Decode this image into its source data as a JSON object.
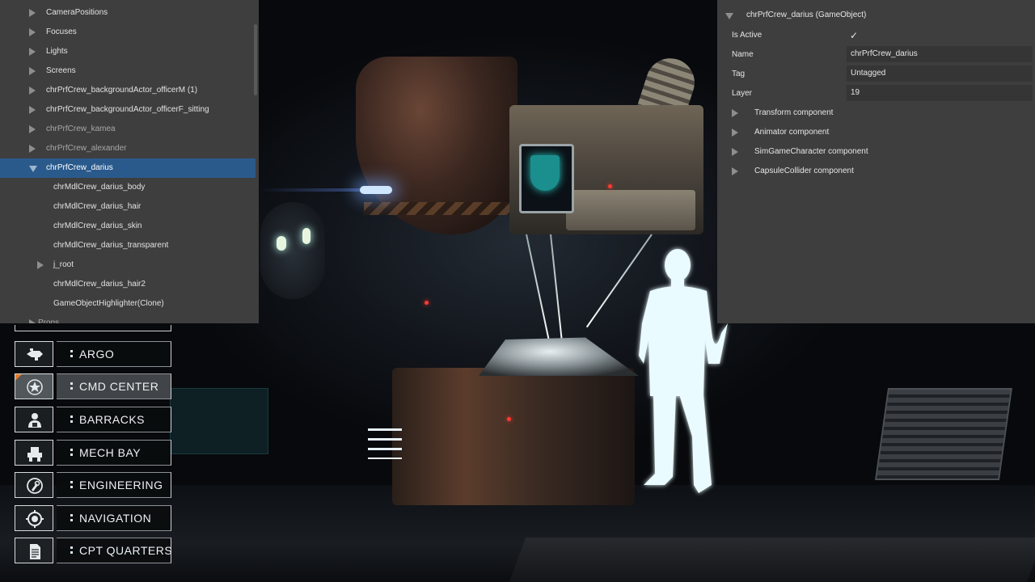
{
  "hierarchy": {
    "items": [
      {
        "label": "CameraPositions",
        "expander": "collapsed",
        "style": "normal"
      },
      {
        "label": "Focuses",
        "expander": "collapsed",
        "style": "normal"
      },
      {
        "label": "Lights",
        "expander": "collapsed",
        "style": "normal"
      },
      {
        "label": "Screens",
        "expander": "collapsed",
        "style": "normal"
      },
      {
        "label": "chrPrfCrew_backgroundActor_officerM (1)",
        "expander": "collapsed",
        "style": "normal"
      },
      {
        "label": "chrPrfCrew_backgroundActor_officerF_sitting",
        "expander": "collapsed",
        "style": "normal"
      },
      {
        "label": "chrPrfCrew_kamea",
        "expander": "collapsed",
        "style": "dim"
      },
      {
        "label": "chrPrfCrew_alexander",
        "expander": "collapsed",
        "style": "dim"
      },
      {
        "label": "chrPrfCrew_darius",
        "expander": "expanded",
        "style": "selected"
      },
      {
        "label": "chrMdlCrew_darius_body",
        "expander": "none",
        "style": "normal"
      },
      {
        "label": "chrMdlCrew_darius_hair",
        "expander": "none",
        "style": "normal"
      },
      {
        "label": "chrMdlCrew_darius_skin",
        "expander": "none",
        "style": "normal"
      },
      {
        "label": "chrMdlCrew_darius_transparent",
        "expander": "none",
        "style": "normal"
      },
      {
        "label": "j_root",
        "expander": "collapsed",
        "style": "normal"
      },
      {
        "label": "chrMdlCrew_darius_hair2",
        "expander": "none",
        "style": "normal"
      },
      {
        "label": "GameObjectHighlighter(Clone)",
        "expander": "none",
        "style": "normal"
      },
      {
        "label": "Props",
        "expander": "collapsed",
        "style": "dim"
      }
    ]
  },
  "inspector": {
    "title": "chrPrfCrew_darius (GameObject)",
    "is_active_label": "Is Active",
    "is_active_check": "✓",
    "name_label": "Name",
    "name_value": "chrPrfCrew_darius",
    "tag_label": "Tag",
    "tag_value": "Untagged",
    "layer_label": "Layer",
    "layer_value": "19",
    "components": [
      {
        "label": "Transform component"
      },
      {
        "label": "Animator component"
      },
      {
        "label": "SimGameCharacter component"
      },
      {
        "label": "CapsuleCollider component"
      }
    ]
  },
  "menu": {
    "accent_color": "#e57a2a",
    "items": [
      {
        "label": "ARGO",
        "icon": "ship-icon",
        "active": false
      },
      {
        "label": "CMD CENTER",
        "icon": "star-compass-icon",
        "active": true
      },
      {
        "label": "BARRACKS",
        "icon": "crew-icon",
        "active": false
      },
      {
        "label": "MECH BAY",
        "icon": "mech-icon",
        "active": false
      },
      {
        "label": "ENGINEERING",
        "icon": "wrench-gear-icon",
        "active": false
      },
      {
        "label": "NAVIGATION",
        "icon": "navigation-icon",
        "active": false
      },
      {
        "label": "CPT QUARTERS",
        "icon": "document-icon",
        "active": false
      }
    ]
  },
  "colors": {
    "panel_bg": "#3e3e3e",
    "selection": "#2a5a8c",
    "silhouette_glow": "#e9fbff"
  }
}
